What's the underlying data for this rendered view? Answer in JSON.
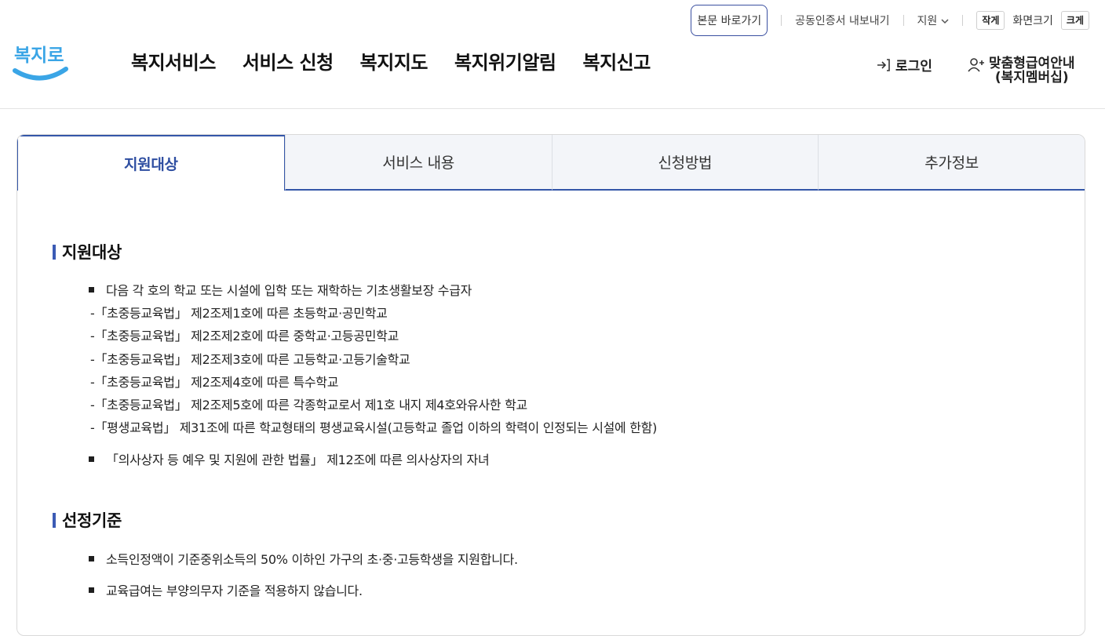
{
  "utility": {
    "skip_label": "본문 바로가기",
    "cert_label": "공동인증서 내보내기",
    "support_label": "지원",
    "small_label": "작게",
    "size_label": "화면크기",
    "large_label": "크게"
  },
  "header": {
    "logo_text": "복지로",
    "nav": [
      "복지서비스",
      "서비스 신청",
      "복지지도",
      "복지위기알림",
      "복지신고"
    ],
    "login_label": "로그인",
    "member_line1": "맞춤형급여안내",
    "member_line2": "(복지멤버십)"
  },
  "tabs": [
    "지원대상",
    "서비스 내용",
    "신청방법",
    "추가정보"
  ],
  "active_tab": 0,
  "sections": {
    "target": {
      "title": "지원대상",
      "item1": "다음 각 호의 학교 또는 시설에 입학 또는 재학하는 기초생활보장 수급자",
      "subs": [
        "-「초중등교육법」 제2조제1호에 따른 초등학교·공민학교",
        "-「초중등교육법」 제2조제2호에 따른 중학교·고등공민학교",
        "-「초중등교육법」 제2조제3호에 따른 고등학교·고등기술학교",
        "-「초중등교육법」 제2조제4호에 따른 특수학교",
        "-「초중등교육법」 제2조제5호에 따른 각종학교로서 제1호 내지 제4호와유사한 학교",
        "-「평생교육법」 제31조에 따른 학교형태의 평생교육시설(고등학교 졸업 이하의 학력이 인정되는 시설에 한함)"
      ],
      "item2": "「의사상자 등 예우 및 지원에 관한 법률」 제12조에 따른 의사상자의 자녀"
    },
    "criteria": {
      "title": "선정기준",
      "items": [
        "소득인정액이 기준중위소득의 50% 이하인 가구의 초·중·고등학생을 지원합니다.",
        "교육급여는 부양의무자 기준을 적용하지 않습니다."
      ]
    }
  },
  "colors": {
    "accent": "#2e4ea1",
    "logo_blue": "#3aa5e6",
    "tab_bg": "#f3f5f9"
  }
}
